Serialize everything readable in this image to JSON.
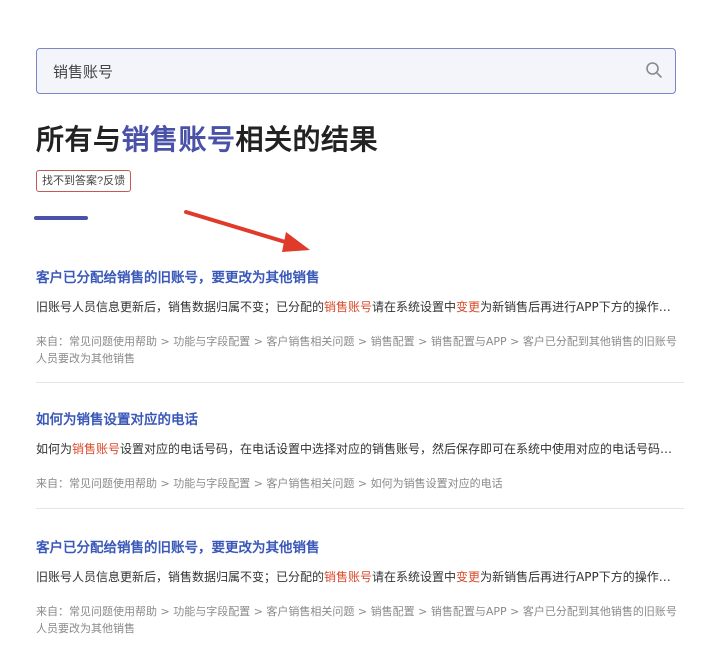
{
  "search": {
    "value": "销售账号",
    "placeholder": "销售账号"
  },
  "title": {
    "prefix": "所有与",
    "keyword": "销售账号",
    "suffix": "相关的结果"
  },
  "feedback_label": "找不到答案?反馈",
  "results": [
    {
      "title": "客户已分配给销售的旧账号，要更改为其他销售",
      "snippet_before": "旧账号人员信息更新后，销售数据归属不变；已分配的",
      "snippet_keyword_1": "销售账号",
      "snippet_middle": "请在系统设置中",
      "snippet_keyword_2": "变更",
      "snippet_after": "为新销售后再进行APP下方的操作…",
      "meta": "来自：常见问题使用帮助 > 功能与字段配置 > 客户销售相关问题 > 销售配置 > 销售配置与APP > 客户已分配到其他销售的旧账号人员要改为其他销售"
    },
    {
      "title": "如何为销售设置对应的电话",
      "snippet_before": "如何为",
      "snippet_keyword_1": "销售账号",
      "snippet_middle": "设置对应的电话号码，在电话设置中选择对应的销售账号，",
      "snippet_keyword_2": "",
      "snippet_after": "然后保存即可在系统中使用对应的电话号码…",
      "meta": "来自：常见问题使用帮助 > 功能与字段配置 > 客户销售相关问题 > 如何为销售设置对应的电话"
    },
    {
      "title": "客户已分配给销售的旧账号，要更改为其他销售",
      "snippet_before": "旧账号人员信息更新后，销售数据归属不变；已分配的",
      "snippet_keyword_1": "销售账号",
      "snippet_middle": "请在系统设置中",
      "snippet_keyword_2": "变更",
      "snippet_after": "为新销售后再进行APP下方的操作…",
      "meta": "来自：常见问题使用帮助 > 功能与字段配置 > 客户销售相关问题 > 销售配置 > 销售配置与APP > 客户已分配到其他销售的旧账号人员要改为其他销售"
    }
  ]
}
